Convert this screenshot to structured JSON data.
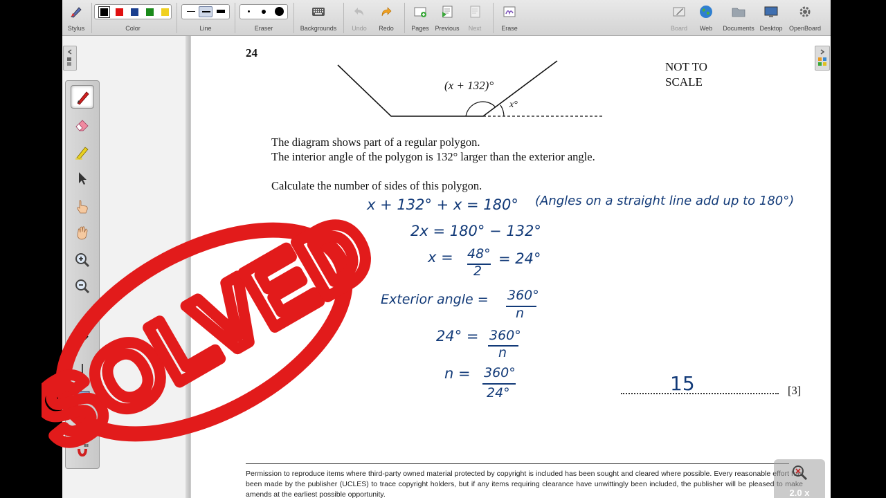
{
  "toolbar": {
    "stylus": "Stylus",
    "color": "Color",
    "line": "Line",
    "eraser": "Eraser",
    "backgrounds": "Backgrounds",
    "undo": "Undo",
    "redo": "Redo",
    "pages": "Pages",
    "previous": "Previous",
    "next": "Next",
    "erase": "Erase",
    "board": "Board",
    "web": "Web",
    "documents": "Documents",
    "desktop": "Desktop",
    "openboard": "OpenBoard"
  },
  "colors": [
    "#000000",
    "#e01010",
    "#1a3f8f",
    "#1a8a1a",
    "#f0d020"
  ],
  "question": {
    "number": "24",
    "not_to_scale": [
      "NOT TO",
      "SCALE"
    ],
    "diagram_label_interior": "(x + 132)°",
    "diagram_label_exterior": "x°",
    "line1": "The diagram shows part of a regular polygon.",
    "line2": "The interior angle of the polygon is 132° larger than the exterior angle.",
    "line3": "Calculate the number of sides of this polygon.",
    "marks": "[3]"
  },
  "handwriting": {
    "eq1": "x + 132° + x = 180°",
    "note1": "(Angles on a straight line add up to 180°)",
    "eq2": "2x = 180° − 132°",
    "eq3_lhs": "x =",
    "eq3_num": "48°",
    "eq3_den": "2",
    "eq3_rhs": "= 24°",
    "eq4_lhs": "Exterior angle =",
    "eq4_num": "360°",
    "eq4_den": "n",
    "eq5_lhs": "24° =",
    "eq5_num": "360°",
    "eq5_den": "n",
    "eq6_lhs": "n =",
    "eq6_num": "360°",
    "eq6_den": "24°",
    "answer": "15"
  },
  "stamp_text": "SOLVED",
  "footer": "Permission to reproduce items where third-party owned material protected by copyright is included has been sought and cleared where possible. Every reasonable effort has been made by the publisher (UCLES) to trace copyright holders, but if any items requiring clearance have unwittingly been included, the publisher will be pleased to make amends at the earliest possible opportunity.",
  "zoom": "2.0 x"
}
